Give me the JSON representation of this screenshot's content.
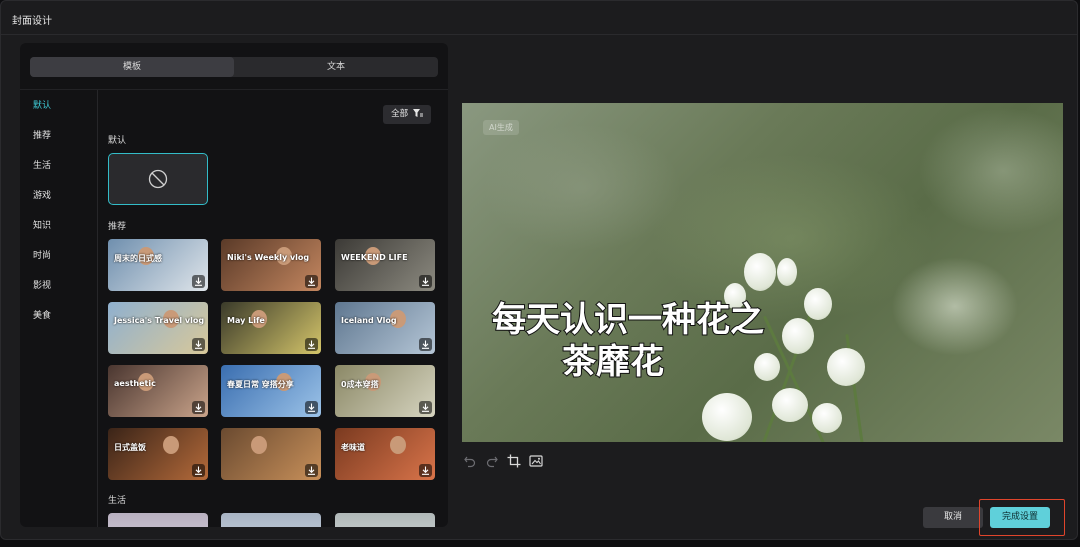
{
  "dialog": {
    "title": "封面设计"
  },
  "tabs": [
    {
      "label": "模板",
      "active": true
    },
    {
      "label": "文本",
      "active": false
    }
  ],
  "categories": [
    {
      "label": "默认",
      "active": true
    },
    {
      "label": "推荐"
    },
    {
      "label": "生活"
    },
    {
      "label": "游戏"
    },
    {
      "label": "知识"
    },
    {
      "label": "时尚"
    },
    {
      "label": "影视"
    },
    {
      "label": "美食"
    }
  ],
  "filter": {
    "label": "全部",
    "icon": "filter-icon"
  },
  "sections": {
    "default": "默认",
    "recommended": "推荐",
    "life": "生活"
  },
  "templates": [
    {
      "caption": "周末的日式感",
      "colors": [
        "#6f8fae",
        "#dfe5ea"
      ]
    },
    {
      "caption": "Niki's Weekly vlog",
      "colors": [
        "#5a3a28",
        "#c48760"
      ]
    },
    {
      "caption": "WEEKEND LIFE",
      "colors": [
        "#3c3a36",
        "#8c8a80"
      ]
    },
    {
      "caption": "Jessica's Travel vlog",
      "colors": [
        "#8fb0cf",
        "#d8c89a"
      ]
    },
    {
      "caption": "May Life",
      "colors": [
        "#3a3a2a",
        "#d4c56a"
      ]
    },
    {
      "caption": "Iceland Vlog",
      "colors": [
        "#5f7790",
        "#b5c6d6"
      ]
    },
    {
      "caption": "aesthetic",
      "colors": [
        "#4a3630",
        "#c9a38a"
      ]
    },
    {
      "caption": "春夏日常 穿搭分享",
      "colors": [
        "#3a6eb0",
        "#9cc3e8"
      ]
    },
    {
      "caption": "0成本穿搭",
      "colors": [
        "#8b8866",
        "#d6d4c0"
      ]
    },
    {
      "caption": "日式盖饭",
      "colors": [
        "#3a2418",
        "#b46a3a"
      ]
    },
    {
      "caption": "",
      "colors": [
        "#6a4a30",
        "#c8905a"
      ]
    },
    {
      "caption": "老味道",
      "colors": [
        "#7a3a20",
        "#d9744a"
      ]
    }
  ],
  "life_templates": [
    {
      "colors": [
        "#b8b0c0",
        "#e0dae4"
      ]
    },
    {
      "colors": [
        "#a8b4c4",
        "#d6dee8"
      ]
    },
    {
      "colors": [
        "#b0b8b8",
        "#dde2e2"
      ]
    }
  ],
  "preview": {
    "badge": "AI生成",
    "caption_line1": "每天认识一种花之",
    "caption_line2": "茶靡花"
  },
  "toolbar": {
    "icons": [
      "undo-icon",
      "redo-icon",
      "crop-icon",
      "replace-image-icon"
    ]
  },
  "actions": {
    "cancel": "取消",
    "done": "完成设置"
  },
  "colors": {
    "accent": "#3fcbd6",
    "done_button": "#5fd0da",
    "highlight_border": "#e0452c"
  }
}
